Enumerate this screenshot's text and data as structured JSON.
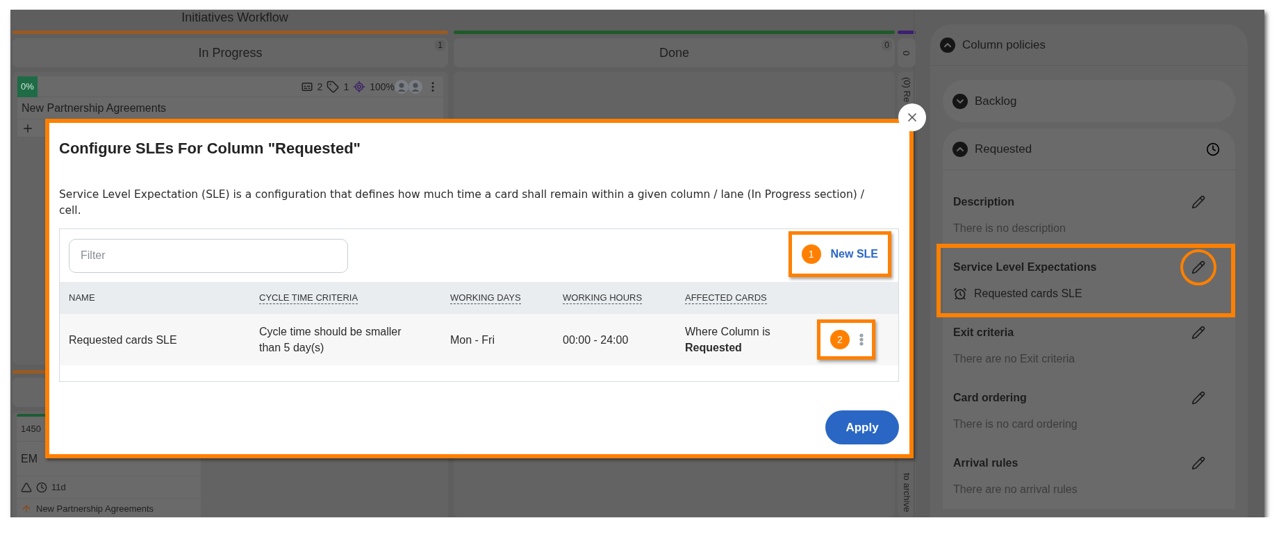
{
  "board": {
    "title": "Initiatives Workflow",
    "columns": [
      {
        "name": "In Progress",
        "count": "1",
        "color": "#9a5a22"
      },
      {
        "name": "Done",
        "count": "0",
        "color": "#1f5a2a"
      },
      {
        "count": "0",
        "color": "#3d1f70",
        "label": "(0) Re",
        "footer": "to archive"
      }
    ],
    "card": {
      "progress": "0%",
      "comments": "2",
      "tags": "1",
      "goal": "100%",
      "title": "New Partnership Agreements"
    },
    "lane_2": {
      "color": "#9a5a22",
      "card": {
        "id": "1450",
        "title": "EM",
        "age": "11d",
        "parent": "New Partnership Agreements"
      }
    }
  },
  "dialog": {
    "title": "Configure SLEs For Column \"Requested\"",
    "description": "Service Level Expectation (SLE) is a configuration that defines how much time a card shall remain within a given column / lane (In Progress section) / cell.",
    "filter": {
      "placeholder": "Filter"
    },
    "new_button": {
      "label": "New SLE",
      "callout": "1"
    },
    "columns": [
      {
        "label": "NAME",
        "dashed": false
      },
      {
        "label": "CYCLE TIME CRITERIA",
        "dashed": true
      },
      {
        "label": "WORKING DAYS",
        "dashed": true
      },
      {
        "label": "WORKING HOURS",
        "dashed": true
      },
      {
        "label": "AFFECTED CARDS",
        "dashed": true
      }
    ],
    "rows": [
      {
        "cells": [
          "Requested cards SLE",
          "Cycle time should be smaller than 5 day(s)",
          "Mon - Fri",
          "00:00 - 24:00",
          "Where Column is **Requested**"
        ],
        "callout": "2"
      }
    ],
    "apply": "Apply"
  },
  "side_panel": {
    "title": "Column policies",
    "expanded": true,
    "sections": [
      {
        "name": "Backlog",
        "expanded": false,
        "sle_icon": false
      },
      {
        "name": "Requested",
        "expanded": true,
        "sle_icon": true,
        "policies": [
          {
            "kind": "text",
            "title": "Description",
            "text": "There is no description",
            "highlighted": false
          },
          {
            "kind": "sle",
            "title": "Service Level Expectations",
            "text": "Requested cards SLE",
            "highlighted": true
          },
          {
            "kind": "text",
            "title": "Exit criteria",
            "text": "There are no Exit criteria",
            "highlighted": false
          },
          {
            "kind": "text",
            "title": "Card ordering",
            "text": "There is no card ordering",
            "highlighted": false
          },
          {
            "kind": "text",
            "title": "Arrival rules",
            "text": "There are no arrival rules",
            "highlighted": false
          }
        ]
      }
    ]
  }
}
